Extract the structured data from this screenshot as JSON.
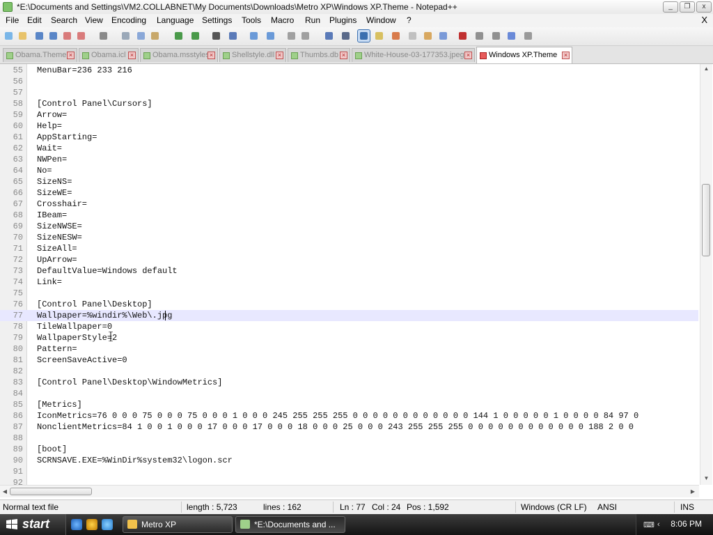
{
  "window": {
    "title": "*E:\\Documents and Settings\\VM2.COLLABNET\\My Documents\\Downloads\\Metro XP\\Windows XP.Theme - Notepad++",
    "buttons": [
      "_",
      "❐",
      "x"
    ]
  },
  "menu": {
    "items": [
      "File",
      "Edit",
      "Search",
      "View",
      "Encoding",
      "Language",
      "Settings",
      "Tools",
      "Macro",
      "Run",
      "Plugins",
      "Window",
      "?"
    ],
    "close": "X"
  },
  "toolbar": {
    "icons": [
      "new-file-icon",
      "open-file-icon",
      "save-icon",
      "save-all-icon",
      "close-file-icon",
      "close-all-icon",
      "print-icon",
      "cut-icon",
      "copy-icon",
      "paste-icon",
      "undo-icon",
      "redo-icon",
      "find-icon",
      "replace-icon",
      "zoom-in-icon",
      "zoom-out-icon",
      "sync-vertical-icon",
      "sync-horizontal-icon",
      "word-wrap-icon",
      "show-all-chars-icon",
      "indent-guide-icon",
      "user-defined-lang-icon",
      "doc-map-icon",
      "function-list-icon",
      "folder-workspace-icon",
      "monitoring-icon",
      "record-macro-icon",
      "stop-macro-icon",
      "play-macro-icon",
      "run-macro-multiple-icon",
      "save-macro-icon"
    ],
    "active_index": 20
  },
  "tabs": [
    {
      "label": "Obama.Theme",
      "active": false
    },
    {
      "label": "Obama.icl",
      "active": false
    },
    {
      "label": "Obama.msstyles",
      "active": false
    },
    {
      "label": "Shellstyle.dll",
      "active": false
    },
    {
      "label": "Thumbs.db",
      "active": false
    },
    {
      "label": "White-House-03-177353.jpeg",
      "active": false
    },
    {
      "label": "Windows XP.Theme",
      "active": true
    }
  ],
  "editor": {
    "current_line": 77,
    "lines": [
      {
        "n": "55",
        "text": "MenuBar=236 233 216"
      },
      {
        "n": "56",
        "text": ""
      },
      {
        "n": "57",
        "text": ""
      },
      {
        "n": "58",
        "text": "[Control Panel\\Cursors]"
      },
      {
        "n": "59",
        "text": "Arrow="
      },
      {
        "n": "60",
        "text": "Help="
      },
      {
        "n": "61",
        "text": "AppStarting="
      },
      {
        "n": "62",
        "text": "Wait="
      },
      {
        "n": "63",
        "text": "NWPen="
      },
      {
        "n": "64",
        "text": "No="
      },
      {
        "n": "65",
        "text": "SizeNS="
      },
      {
        "n": "66",
        "text": "SizeWE="
      },
      {
        "n": "67",
        "text": "Crosshair="
      },
      {
        "n": "68",
        "text": "IBeam="
      },
      {
        "n": "69",
        "text": "SizeNWSE="
      },
      {
        "n": "70",
        "text": "SizeNESW="
      },
      {
        "n": "71",
        "text": "SizeAll="
      },
      {
        "n": "72",
        "text": "UpArrow="
      },
      {
        "n": "73",
        "text": "DefaultValue=Windows default"
      },
      {
        "n": "74",
        "text": "Link="
      },
      {
        "n": "75",
        "text": ""
      },
      {
        "n": "76",
        "text": "[Control Panel\\Desktop]"
      },
      {
        "n": "77",
        "text": "Wallpaper=%windir%\\Web\\.jpg"
      },
      {
        "n": "78",
        "text": "TileWallpaper=0"
      },
      {
        "n": "79",
        "text": "WallpaperStyle=2"
      },
      {
        "n": "80",
        "text": "Pattern="
      },
      {
        "n": "81",
        "text": "ScreenSaveActive=0"
      },
      {
        "n": "82",
        "text": ""
      },
      {
        "n": "83",
        "text": "[Control Panel\\Desktop\\WindowMetrics]"
      },
      {
        "n": "84",
        "text": ""
      },
      {
        "n": "85",
        "text": "[Metrics]"
      },
      {
        "n": "86",
        "text": "IconMetrics=76 0 0 0 75 0 0 0 75 0 0 0 1 0 0 0 245 255 255 255 0 0 0 0 0 0 0 0 0 0 0 0 144 1 0 0 0 0 0 1 0 0 0 0 84 97 0"
      },
      {
        "n": "87",
        "text": "NonclientMetrics=84 1 0 0 1 0 0 0 17 0 0 0 17 0 0 0 18 0 0 0 25 0 0 0 243 255 255 255 0 0 0 0 0 0 0 0 0 0 0 0 188 2 0 0"
      },
      {
        "n": "88",
        "text": ""
      },
      {
        "n": "89",
        "text": "[boot]"
      },
      {
        "n": "90",
        "text": "SCRNSAVE.EXE=%WinDir%system32\\logon.scr"
      },
      {
        "n": "91",
        "text": ""
      },
      {
        "n": "92",
        "text": ""
      }
    ]
  },
  "status": {
    "type": "Normal text file",
    "length": "length : 5,723",
    "lines": "lines : 162",
    "ln": "Ln : 77",
    "col": "Col : 24",
    "pos": "Pos : 1,592",
    "eol": "Windows (CR LF)",
    "encoding": "ANSI",
    "mode": "INS"
  },
  "taskbar": {
    "start_label": "start",
    "quicklaunch": [
      "ie-icon",
      "winamp-icon",
      "explorer-icon"
    ],
    "tasks": [
      {
        "label": "Metro XP",
        "icon": "folder-icon",
        "active": false
      },
      {
        "label": "*E:\\Documents and ...",
        "icon": "notepadpp-icon",
        "active": true
      }
    ],
    "clock": "8:06 PM"
  },
  "colors": {
    "current_line": "#e8e8ff",
    "active_tab_icon": "#e85b5b",
    "taskbar": "#1e1e1e"
  }
}
